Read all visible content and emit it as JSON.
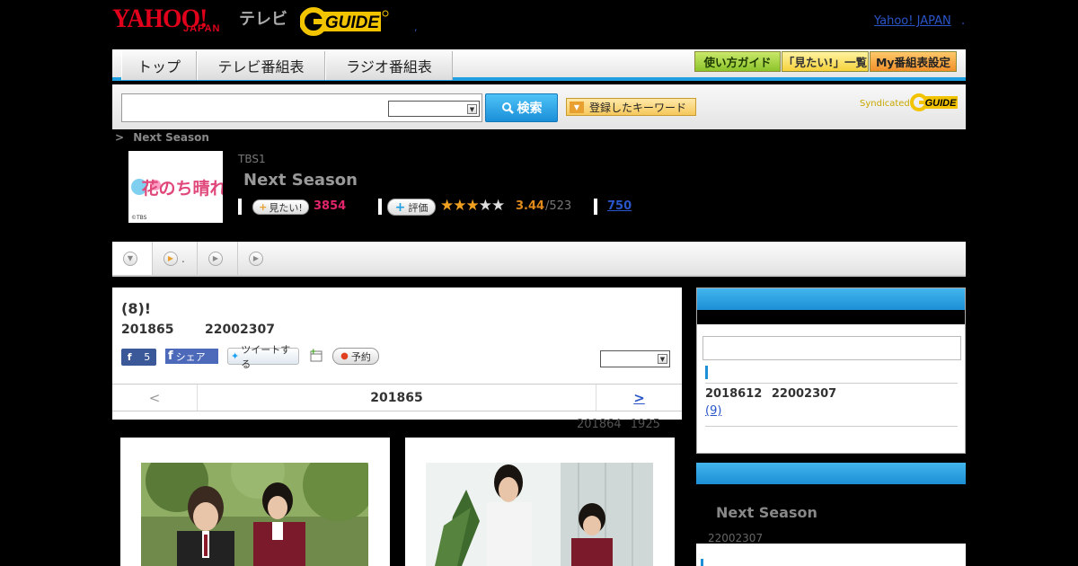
{
  "header": {
    "logo_yahoo": "YAHOO!",
    "logo_japan": "JAPAN",
    "logo_tv": "テレビ",
    "logo_gguide": "G-GUIDE",
    "yahoo_japan_link": "Yahoo! JAPAN",
    "link_dot": ".",
    "dot": ","
  },
  "nav": {
    "tabs": [
      "トップ",
      "テレビ番組表",
      "ラジオ番組表"
    ],
    "buttons": [
      "使い方ガイド",
      "「見たい!」一覧",
      "My番組表設定"
    ]
  },
  "search": {
    "button_label": "検索",
    "keyword_button": "登録したキーワード",
    "syndicated": "Syndicated",
    "gguide_small": "G-GUIDE"
  },
  "program": {
    "breadcrumb_sep": ">",
    "breadcrumb": "Next Season",
    "channel": "TBS1",
    "title": "Next Season",
    "thumb_text": "花のち晴れ",
    "thumb_corner": "©TBS",
    "mitai_label": "見たい!",
    "mitai_count": "3854",
    "hyoka_label": "評価",
    "rating": "3.44",
    "rating_count": "/523",
    "comment_count": "750",
    "stars_filled": 3,
    "stars_total": 5
  },
  "tabs": {
    "tab2_suffix": "."
  },
  "episode": {
    "title": "(8)!",
    "date": "201865",
    "time": "22002307",
    "fb_like_count": "5",
    "fb_share": "シェア",
    "tweet": "ツイートする",
    "yoyaku": "予約",
    "prev": "<",
    "nav_date": "201865",
    "next": ">",
    "updated_date": "201864",
    "updated_time": "1925"
  },
  "side1": {
    "next_date": "2018612",
    "next_time": "22002307",
    "next_ep": "(9)"
  },
  "side2": {
    "title": "Next Season",
    "time": "22002307"
  },
  "colors": {
    "accent_blue": "#1f9fe0",
    "yahoo_red": "#e0001b",
    "gguide_yellow": "#f2c400",
    "mitai_pink": "#e0256b",
    "rating_orange": "#e08a1c",
    "link_blue": "#2a55c8"
  }
}
